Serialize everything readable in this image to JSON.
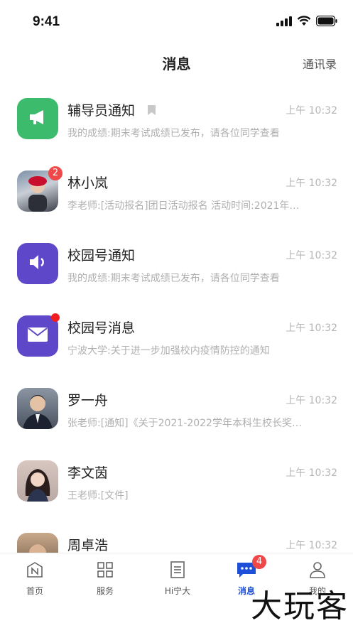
{
  "status_bar": {
    "time": "9:41"
  },
  "header": {
    "title": "消息",
    "contacts_label": "通讯录"
  },
  "messages": [
    {
      "name": "辅导员通知",
      "time": "上午 10:32",
      "preview": "我的成绩:期末考试成绩已发布，请各位同学查看",
      "avatar_icon": "megaphone-icon",
      "avatar_color": "#3dbb6c"
    },
    {
      "name": "林小岚",
      "time": "上午 10:32",
      "preview": "李老师:[活动报名]团日活动报名 活动时间:2021年…",
      "badge": "2"
    },
    {
      "name": "校园号通知",
      "time": "上午 10:32",
      "preview": "我的成绩:期末考试成绩已发布，请各位同学查看",
      "avatar_icon": "speaker-icon",
      "avatar_color": "#5e47c9"
    },
    {
      "name": "校园号消息",
      "time": "上午 10:32",
      "preview": "宁波大学:关于进一步加强校内疫情防控的通知",
      "avatar_icon": "mail-icon",
      "avatar_color": "#5e47c9"
    },
    {
      "name": "罗一舟",
      "time": "上午 10:32",
      "preview": "张老师:[通知]《关于2021-2022学年本科生校长奖…"
    },
    {
      "name": "李文茵",
      "time": "上午 10:32",
      "preview": "王老师:[文件]"
    },
    {
      "name": "周卓浩",
      "time": "上午 10:32",
      "preview": ""
    }
  ],
  "tabs": [
    {
      "label": "首页"
    },
    {
      "label": "服务"
    },
    {
      "label": "Hi宁大"
    },
    {
      "label": "消息",
      "badge": "4"
    },
    {
      "label": "我的"
    }
  ],
  "watermark": "大玩客",
  "colors": {
    "accent": "#1e4fd8",
    "badge": "#f04848"
  }
}
